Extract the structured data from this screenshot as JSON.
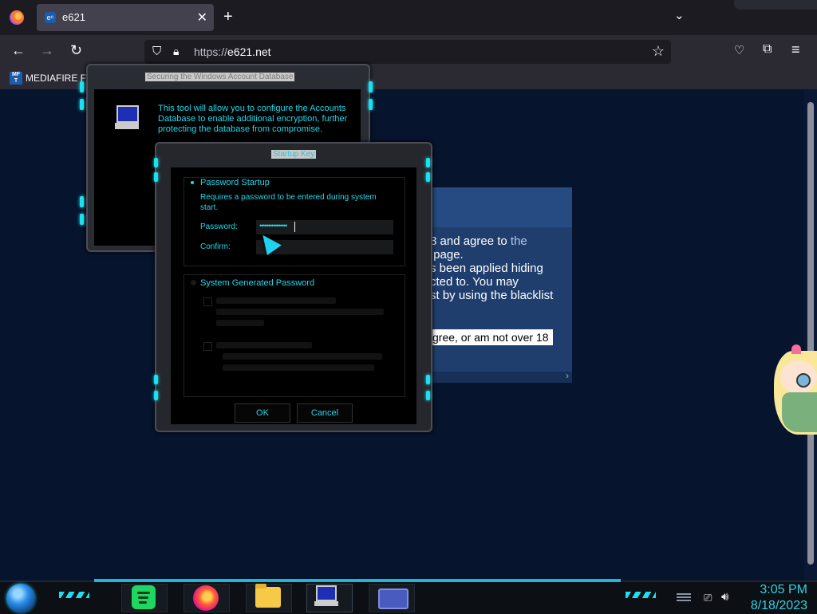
{
  "browser": {
    "tab": {
      "title": "e621",
      "favicon_text": "e⁶"
    },
    "url": {
      "scheme": "https://",
      "host": "e621.net"
    },
    "bookmarks": [
      {
        "label": "MEDIAFIRE F",
        "icon_text": "MF T"
      }
    ]
  },
  "age_gate": {
    "lines": [
      "8 and agree to ",
      " page.",
      "s been applied hiding",
      "cted to. You may",
      "st by using the blacklist"
    ],
    "link_text": "the",
    "decline_button": "gree, or am not over 18"
  },
  "dialog_back": {
    "title": "Securing the Windows Account Database",
    "description": "This tool will allow you to configure the Accounts Database to enable additional encryption, further protecting the database from compromise."
  },
  "dialog_startup_key": {
    "title": "Startup Key",
    "option_password": {
      "label": "Password Startup",
      "description": "Requires a password to be entered during system start.",
      "password_label": "Password:",
      "password_value": "••••••••••••••••",
      "confirm_label": "Confirm:",
      "confirm_value": ""
    },
    "option_system": {
      "label": "System Generated Password"
    },
    "ok_button": "OK",
    "cancel_button": "Cancel"
  },
  "taskbar": {
    "clock_time": "3:05 PM",
    "clock_date": "8/18/2023"
  },
  "colors": {
    "accent_cyan": "#1ce0f0",
    "page_bg": "#07142e",
    "age_gate_bg": "#1f3e6e"
  }
}
